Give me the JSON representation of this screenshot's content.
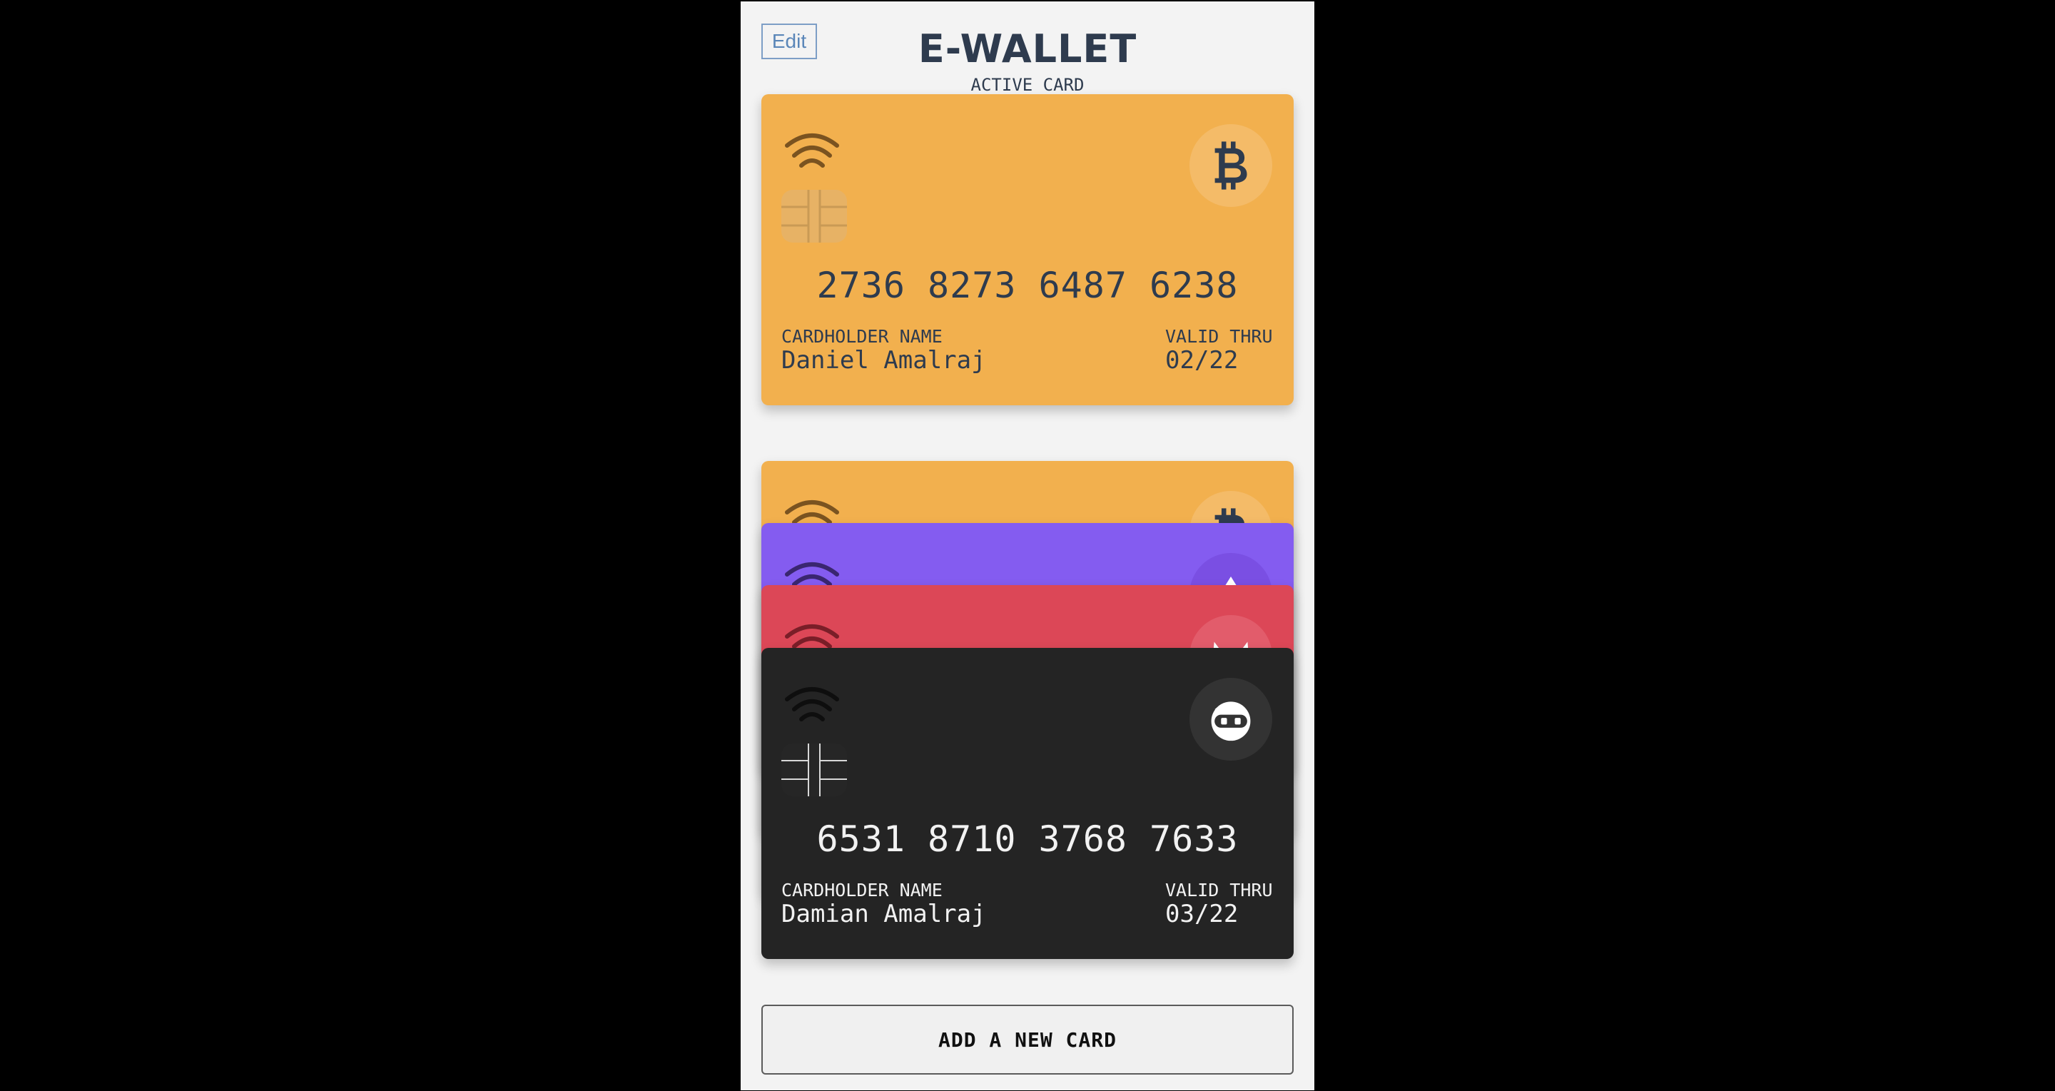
{
  "header": {
    "edit_label": "Edit",
    "title": "E-WALLET",
    "subtitle": "ACTIVE CARD"
  },
  "active_card": {
    "number": "2736 8273 6487 6238",
    "holder_label": "CARDHOLDER NAME",
    "holder_name": "Daniel Amalraj",
    "valid_label": "VALID THRU",
    "valid_thru": "02/22",
    "logo_icon": "bitcoin-icon",
    "color": "#f2b04e"
  },
  "card_stack": [
    {
      "logo_icon": "bitcoin-icon",
      "color": "#f2b04e"
    },
    {
      "logo_icon": "ethereum-icon",
      "color": "#845cf0"
    },
    {
      "logo_icon": "devil-icon",
      "color": "#dc4757"
    },
    {
      "number": "6531 8710 3768 7633",
      "holder_label": "CARDHOLDER NAME",
      "holder_name": "Damian Amalraj",
      "valid_label": "VALID THRU",
      "valid_thru": "03/22",
      "logo_icon": "ninja-icon",
      "color": "#242424"
    }
  ],
  "footer": {
    "add_card_label": "ADD A NEW CARD"
  }
}
